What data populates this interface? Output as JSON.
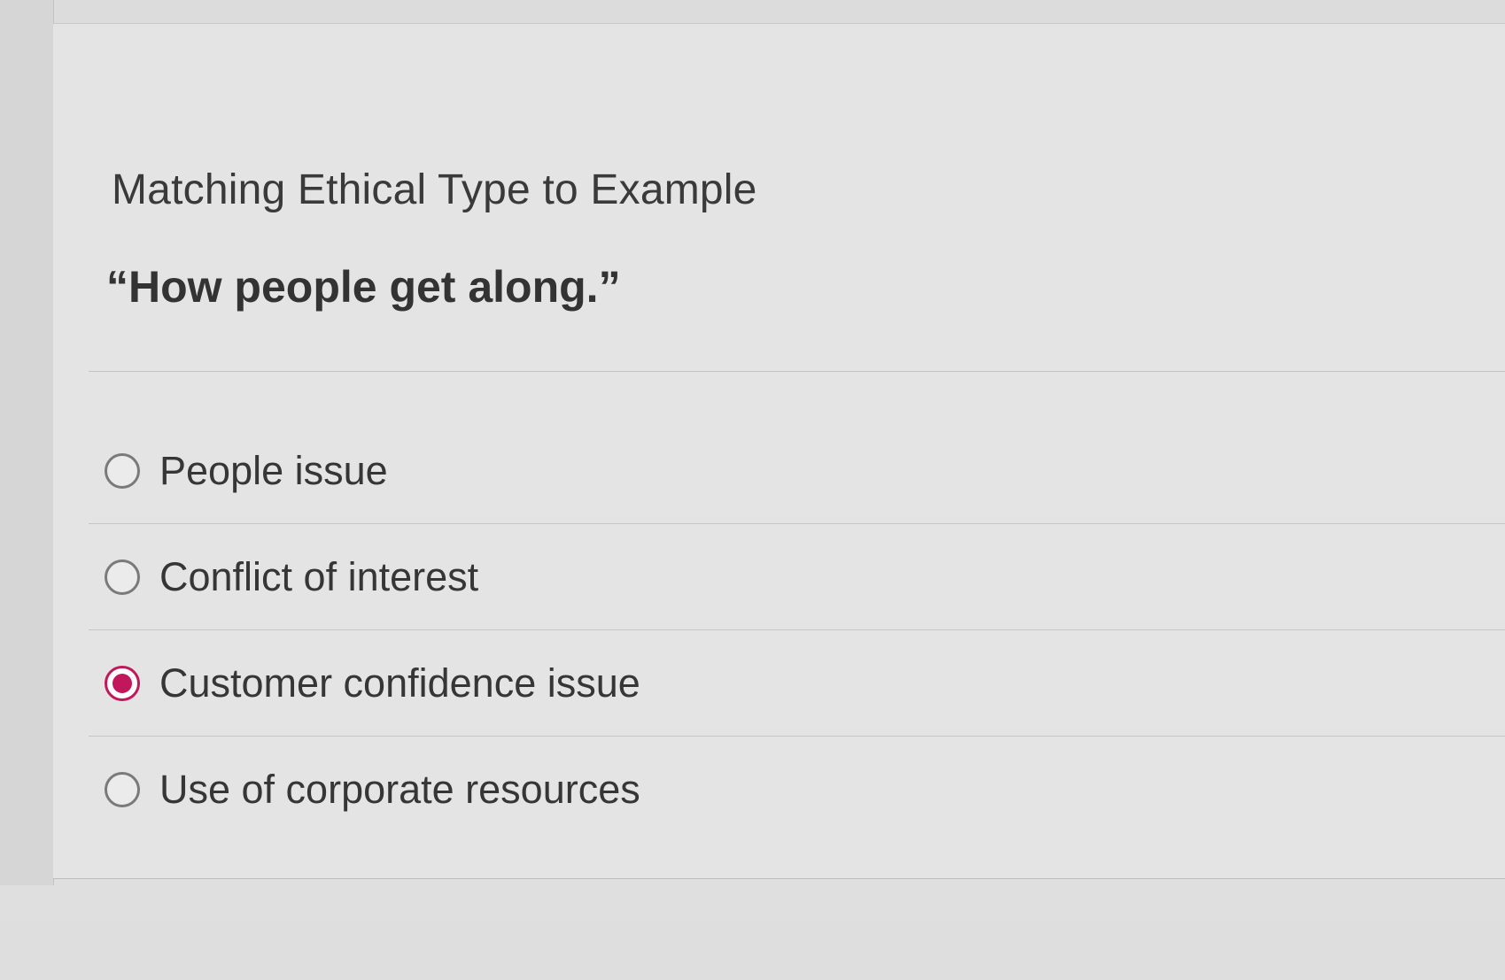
{
  "question": {
    "title": "Matching Ethical Type to Example",
    "prompt": "“How people get along.”"
  },
  "answers": [
    {
      "label": "People issue",
      "selected": false
    },
    {
      "label": "Conflict of interest",
      "selected": false
    },
    {
      "label": "Customer confidence issue",
      "selected": true
    },
    {
      "label": "Use of corporate resources",
      "selected": false
    }
  ],
  "colors": {
    "selected_accent": "#c2185b",
    "radio_border": "#7a7a7a",
    "background": "#e4e4e4"
  }
}
